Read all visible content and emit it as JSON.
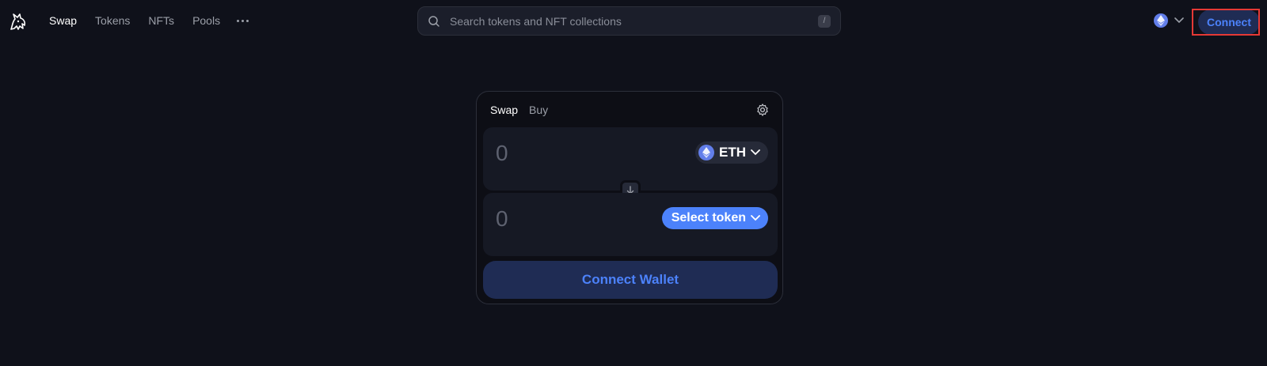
{
  "nav": {
    "logo_icon": "unicorn-logo-icon",
    "links": [
      {
        "label": "Swap",
        "active": true
      },
      {
        "label": "Tokens",
        "active": false
      },
      {
        "label": "NFTs",
        "active": false
      },
      {
        "label": "Pools",
        "active": false
      }
    ],
    "more_icon": "more-horizontal-icon"
  },
  "search": {
    "placeholder": "Search tokens and NFT collections",
    "value": "",
    "shortcut": "/"
  },
  "network": {
    "icon": "ethereum-icon"
  },
  "header": {
    "connect_label": "Connect"
  },
  "swap_card": {
    "tabs": [
      {
        "label": "Swap",
        "active": true
      },
      {
        "label": "Buy",
        "active": false
      }
    ],
    "input": {
      "placeholder": "0",
      "value": "",
      "token": "ETH"
    },
    "output": {
      "placeholder": "0",
      "value": "",
      "token_button": "Select token"
    },
    "connect_wallet_label": "Connect Wallet"
  },
  "colors": {
    "background": "#0f111a",
    "accent": "#4c82fb",
    "accent_soft": "#1f2c54",
    "highlight": "#e53935"
  }
}
